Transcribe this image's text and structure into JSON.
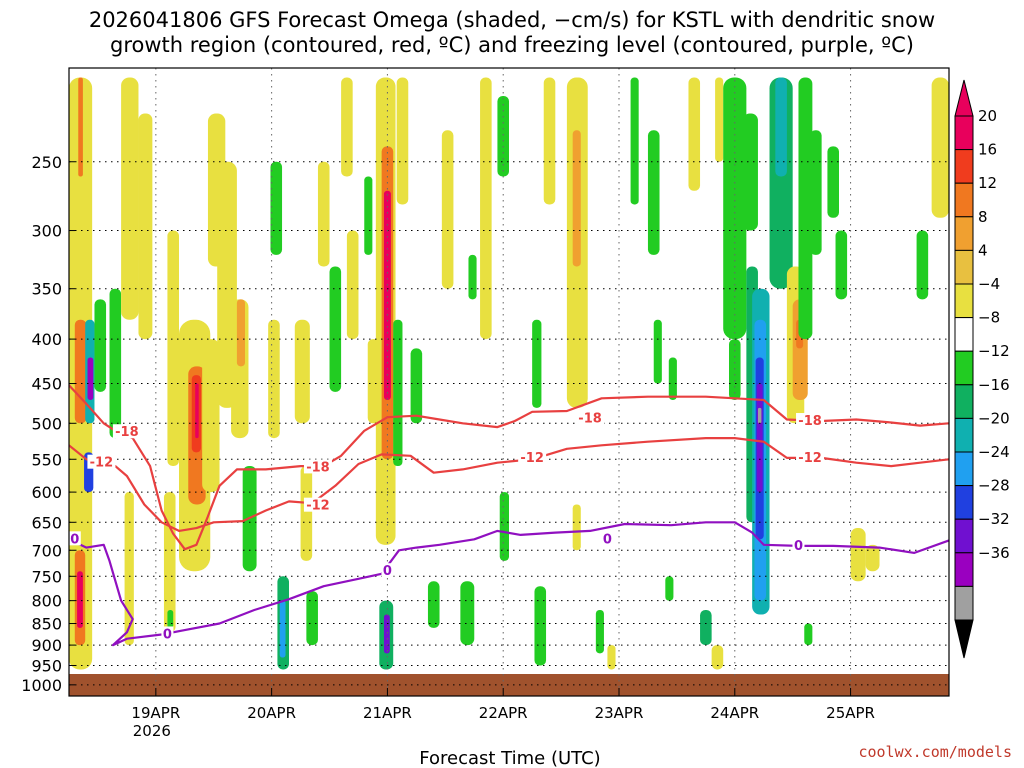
{
  "title_line1": "2026041806 GFS Forecast Omega (shaded, −cm/s) for KSTL with dendritic snow",
  "title_line2": "growth region (contoured, red, ºC) and freezing level (contoured, purple, ºC)",
  "credit": "coolwx.com/models",
  "chart_data": {
    "type": "heatmap",
    "title": "2026041806 GFS Forecast Omega (shaded, −cm/s) for KSTL with dendritic snow growth region (contoured, red, ºC) and freezing level (contoured, purple, ºC)",
    "xlabel": "Forecast Time (UTC)",
    "ylabel": "",
    "y_scale": "log",
    "ylim": [
      1030,
      195
    ],
    "xlim": [
      0,
      7.6
    ],
    "x_ticks": [
      {
        "value": 0.75,
        "label": "19APR",
        "sub": "2026"
      },
      {
        "value": 1.75,
        "label": "20APR"
      },
      {
        "value": 2.75,
        "label": "21APR"
      },
      {
        "value": 3.75,
        "label": "22APR"
      },
      {
        "value": 4.75,
        "label": "23APR"
      },
      {
        "value": 5.75,
        "label": "24APR"
      },
      {
        "value": 6.75,
        "label": "25APR"
      }
    ],
    "y_ticks": [
      250,
      300,
      350,
      400,
      450,
      500,
      550,
      600,
      650,
      700,
      750,
      800,
      850,
      900,
      950,
      1000
    ],
    "grid": true,
    "colorbar": {
      "ticks": [
        "20",
        "16",
        "12",
        "8",
        "4",
        "−4",
        "−8",
        "−12",
        "−16",
        "−20",
        "−24",
        "−28",
        "−32",
        "−36"
      ],
      "colors": [
        "#e8005c",
        "#f03c1e",
        "#f07820",
        "#f0a030",
        "#e8c040",
        "#e8e040",
        "#ffffff",
        "#22cc22",
        "#10b060",
        "#10b0b0",
        "#20a0f0",
        "#2040e0",
        "#7010d0",
        "#9a00c0",
        "#a0a0a0"
      ]
    },
    "series": [
      {
        "name": "-18",
        "color": "#e84040",
        "points": [
          [
            0.0,
            452
          ],
          [
            0.15,
            475
          ],
          [
            0.3,
            500
          ],
          [
            0.4,
            510
          ],
          [
            0.55,
            520
          ],
          [
            0.7,
            560
          ],
          [
            0.8,
            630
          ],
          [
            0.9,
            670
          ],
          [
            1.0,
            698
          ],
          [
            1.1,
            690
          ],
          [
            1.2,
            640
          ],
          [
            1.3,
            590
          ],
          [
            1.45,
            565
          ],
          [
            1.7,
            565
          ],
          [
            2.0,
            560
          ],
          [
            2.2,
            560
          ],
          [
            2.35,
            545
          ],
          [
            2.55,
            510
          ],
          [
            2.75,
            492
          ],
          [
            3.0,
            490
          ],
          [
            3.2,
            495
          ],
          [
            3.4,
            500
          ],
          [
            3.7,
            505
          ],
          [
            3.85,
            497
          ],
          [
            4.0,
            485
          ],
          [
            4.3,
            484
          ],
          [
            4.6,
            468
          ],
          [
            5.0,
            466
          ],
          [
            5.5,
            466
          ],
          [
            5.75,
            468
          ],
          [
            6.0,
            470
          ],
          [
            6.2,
            495
          ],
          [
            6.5,
            497
          ],
          [
            6.8,
            495
          ],
          [
            7.1,
            499
          ],
          [
            7.35,
            503
          ],
          [
            7.6,
            500
          ]
        ]
      },
      {
        "name": "-12",
        "color": "#e84040",
        "points": [
          [
            0.0,
            530
          ],
          [
            0.15,
            550
          ],
          [
            0.4,
            560
          ],
          [
            0.5,
            575
          ],
          [
            0.65,
            620
          ],
          [
            0.8,
            650
          ],
          [
            0.95,
            665
          ],
          [
            1.1,
            660
          ],
          [
            1.25,
            650
          ],
          [
            1.5,
            648
          ],
          [
            1.7,
            630
          ],
          [
            1.9,
            615
          ],
          [
            2.1,
            618
          ],
          [
            2.3,
            590
          ],
          [
            2.5,
            557
          ],
          [
            2.7,
            543
          ],
          [
            2.95,
            545
          ],
          [
            3.15,
            570
          ],
          [
            3.4,
            565
          ],
          [
            3.7,
            555
          ],
          [
            4.0,
            550
          ],
          [
            4.3,
            535
          ],
          [
            4.6,
            530
          ],
          [
            5.0,
            525
          ],
          [
            5.5,
            520
          ],
          [
            5.75,
            520
          ],
          [
            6.0,
            525
          ],
          [
            6.2,
            548
          ],
          [
            6.5,
            548
          ],
          [
            6.8,
            555
          ],
          [
            7.1,
            560
          ],
          [
            7.35,
            555
          ],
          [
            7.6,
            550
          ]
        ]
      },
      {
        "name": "0",
        "color": "#9010c0",
        "points": [
          [
            0.0,
            680
          ],
          [
            0.15,
            695
          ],
          [
            0.3,
            690
          ],
          [
            0.35,
            720
          ],
          [
            0.45,
            800
          ],
          [
            0.55,
            840
          ],
          [
            0.5,
            870
          ],
          [
            0.38,
            900
          ],
          [
            0.5,
            885
          ],
          [
            0.8,
            875
          ],
          [
            1.0,
            865
          ],
          [
            1.3,
            850
          ],
          [
            1.6,
            820
          ],
          [
            1.9,
            797
          ],
          [
            2.2,
            770
          ],
          [
            2.5,
            755
          ],
          [
            2.7,
            745
          ],
          [
            2.85,
            700
          ],
          [
            3.0,
            695
          ],
          [
            3.2,
            690
          ],
          [
            3.5,
            680
          ],
          [
            3.7,
            665
          ],
          [
            3.9,
            672
          ],
          [
            4.2,
            668
          ],
          [
            4.5,
            665
          ],
          [
            4.8,
            653
          ],
          [
            5.2,
            655
          ],
          [
            5.5,
            650
          ],
          [
            5.75,
            650
          ],
          [
            5.9,
            668
          ],
          [
            6.0,
            690
          ],
          [
            6.3,
            692
          ],
          [
            6.6,
            692
          ],
          [
            7.0,
            695
          ],
          [
            7.3,
            705
          ],
          [
            7.6,
            682
          ]
        ]
      }
    ],
    "contour_labels": [
      {
        "text": "-18",
        "x": 0.5,
        "y": 512
      },
      {
        "text": "-18",
        "x": 2.15,
        "y": 562
      },
      {
        "text": "-18",
        "x": 4.5,
        "y": 494
      },
      {
        "text": "-18",
        "x": 6.4,
        "y": 497
      },
      {
        "text": "-12",
        "x": 0.28,
        "y": 555
      },
      {
        "text": "-12",
        "x": 2.15,
        "y": 622
      },
      {
        "text": "-12",
        "x": 4.0,
        "y": 548
      },
      {
        "text": "-12",
        "x": 6.4,
        "y": 548
      },
      {
        "text": "0",
        "x": 0.05,
        "y": 680
      },
      {
        "text": "0",
        "x": 0.85,
        "y": 875
      },
      {
        "text": "0",
        "x": 2.75,
        "y": 740
      },
      {
        "text": "0",
        "x": 4.65,
        "y": 680
      },
      {
        "text": "0",
        "x": 6.3,
        "y": 692
      }
    ],
    "omega_cells": [
      {
        "x0": 0.0,
        "x1": 0.2,
        "p0": 200,
        "p1": 960,
        "v": 6
      },
      {
        "x0": 0.05,
        "x1": 0.15,
        "p0": 380,
        "p1": 500,
        "v": 14
      },
      {
        "x0": 0.05,
        "x1": 0.14,
        "p0": 700,
        "p1": 900,
        "v": 14
      },
      {
        "x0": 0.07,
        "x1": 0.12,
        "p0": 740,
        "p1": 860,
        "v": 22
      },
      {
        "x0": 0.08,
        "x1": 0.12,
        "p0": 200,
        "p1": 260,
        "v": 14
      },
      {
        "x0": 0.14,
        "x1": 0.22,
        "p0": 380,
        "p1": 500,
        "v": -14
      },
      {
        "x0": 0.16,
        "x1": 0.21,
        "p0": 420,
        "p1": 470,
        "v": -30
      },
      {
        "x0": 0.13,
        "x1": 0.21,
        "p0": 540,
        "p1": 600,
        "v": -22
      },
      {
        "x0": 0.22,
        "x1": 0.32,
        "p0": 360,
        "p1": 460,
        "v": -6
      },
      {
        "x0": 0.35,
        "x1": 0.45,
        "p0": 350,
        "p1": 520,
        "v": -6
      },
      {
        "x0": 0.45,
        "x1": 0.6,
        "p0": 200,
        "p1": 380,
        "v": 6
      },
      {
        "x0": 0.48,
        "x1": 0.56,
        "p0": 600,
        "p1": 900,
        "v": 6
      },
      {
        "x0": 0.6,
        "x1": 0.72,
        "p0": 220,
        "p1": 400,
        "v": 6
      },
      {
        "x0": 0.82,
        "x1": 0.92,
        "p0": 600,
        "p1": 870,
        "v": 6
      },
      {
        "x0": 0.85,
        "x1": 0.95,
        "p0": 300,
        "p1": 560,
        "v": 6
      },
      {
        "x0": 0.85,
        "x1": 0.9,
        "p0": 820,
        "p1": 860,
        "v": -6
      },
      {
        "x0": 0.95,
        "x1": 1.22,
        "p0": 380,
        "p1": 740,
        "v": 6
      },
      {
        "x0": 1.03,
        "x1": 1.18,
        "p0": 430,
        "p1": 620,
        "v": 12
      },
      {
        "x0": 1.06,
        "x1": 1.14,
        "p0": 440,
        "p1": 540,
        "v": 18
      },
      {
        "x0": 1.09,
        "x1": 1.12,
        "p0": 450,
        "p1": 520,
        "v": 22
      },
      {
        "x0": 1.15,
        "x1": 1.3,
        "p0": 400,
        "p1": 600,
        "v": 6
      },
      {
        "x0": 1.2,
        "x1": 1.35,
        "p0": 220,
        "p1": 330,
        "v": 6
      },
      {
        "x0": 1.28,
        "x1": 1.45,
        "p0": 250,
        "p1": 480,
        "v": 6
      },
      {
        "x0": 1.4,
        "x1": 1.55,
        "p0": 360,
        "p1": 520,
        "v": 6
      },
      {
        "x0": 1.45,
        "x1": 1.52,
        "p0": 360,
        "p1": 430,
        "v": 10
      },
      {
        "x0": 1.5,
        "x1": 1.62,
        "p0": 560,
        "p1": 740,
        "v": -6
      },
      {
        "x0": 1.72,
        "x1": 1.82,
        "p0": 380,
        "p1": 520,
        "v": 6
      },
      {
        "x0": 1.74,
        "x1": 1.84,
        "p0": 250,
        "p1": 320,
        "v": -6
      },
      {
        "x0": 1.8,
        "x1": 1.9,
        "p0": 750,
        "p1": 960,
        "v": -10
      },
      {
        "x0": 1.82,
        "x1": 1.87,
        "p0": 800,
        "p1": 930,
        "v": -18
      },
      {
        "x0": 1.95,
        "x1": 2.08,
        "p0": 380,
        "p1": 500,
        "v": 6
      },
      {
        "x0": 2.0,
        "x1": 2.1,
        "p0": 560,
        "p1": 720,
        "v": 6
      },
      {
        "x0": 2.05,
        "x1": 2.15,
        "p0": 780,
        "p1": 900,
        "v": -6
      },
      {
        "x0": 2.15,
        "x1": 2.25,
        "p0": 250,
        "p1": 330,
        "v": 6
      },
      {
        "x0": 2.25,
        "x1": 2.35,
        "p0": 330,
        "p1": 460,
        "v": -6
      },
      {
        "x0": 2.35,
        "x1": 2.45,
        "p0": 200,
        "p1": 260,
        "v": 6
      },
      {
        "x0": 2.4,
        "x1": 2.5,
        "p0": 300,
        "p1": 400,
        "v": 6
      },
      {
        "x0": 2.55,
        "x1": 2.62,
        "p0": 260,
        "p1": 320,
        "v": -6
      },
      {
        "x0": 2.58,
        "x1": 2.68,
        "p0": 400,
        "p1": 500,
        "v": 6
      },
      {
        "x0": 2.65,
        "x1": 2.82,
        "p0": 200,
        "p1": 690,
        "v": 6
      },
      {
        "x0": 2.7,
        "x1": 2.8,
        "p0": 240,
        "p1": 550,
        "v": 12
      },
      {
        "x0": 2.72,
        "x1": 2.78,
        "p0": 270,
        "p1": 470,
        "v": 22
      },
      {
        "x0": 2.68,
        "x1": 2.8,
        "p0": 800,
        "p1": 960,
        "v": -10
      },
      {
        "x0": 2.72,
        "x1": 2.77,
        "p0": 830,
        "p1": 920,
        "v": -24
      },
      {
        "x0": 2.8,
        "x1": 2.88,
        "p0": 380,
        "p1": 560,
        "v": -6
      },
      {
        "x0": 2.83,
        "x1": 2.93,
        "p0": 200,
        "p1": 280,
        "v": 6
      },
      {
        "x0": 2.95,
        "x1": 3.05,
        "p0": 410,
        "p1": 500,
        "v": -6
      },
      {
        "x0": 3.1,
        "x1": 3.2,
        "p0": 760,
        "p1": 860,
        "v": -6
      },
      {
        "x0": 3.22,
        "x1": 3.32,
        "p0": 230,
        "p1": 350,
        "v": 6
      },
      {
        "x0": 3.38,
        "x1": 3.5,
        "p0": 760,
        "p1": 900,
        "v": -6
      },
      {
        "x0": 3.45,
        "x1": 3.52,
        "p0": 320,
        "p1": 360,
        "v": -6
      },
      {
        "x0": 3.55,
        "x1": 3.65,
        "p0": 200,
        "p1": 400,
        "v": 6
      },
      {
        "x0": 3.72,
        "x1": 3.8,
        "p0": 600,
        "p1": 720,
        "v": -6
      },
      {
        "x0": 3.7,
        "x1": 3.8,
        "p0": 210,
        "p1": 260,
        "v": -6
      },
      {
        "x0": 4.0,
        "x1": 4.08,
        "p0": 380,
        "p1": 480,
        "v": -6
      },
      {
        "x0": 4.02,
        "x1": 4.12,
        "p0": 770,
        "p1": 950,
        "v": -6
      },
      {
        "x0": 4.1,
        "x1": 4.2,
        "p0": 200,
        "p1": 280,
        "v": 6
      },
      {
        "x0": 4.3,
        "x1": 4.48,
        "p0": 200,
        "p1": 480,
        "v": 6
      },
      {
        "x0": 4.35,
        "x1": 4.42,
        "p0": 230,
        "p1": 330,
        "v": 10
      },
      {
        "x0": 4.35,
        "x1": 4.42,
        "p0": 620,
        "p1": 700,
        "v": 6
      },
      {
        "x0": 4.55,
        "x1": 4.62,
        "p0": 820,
        "p1": 920,
        "v": -6
      },
      {
        "x0": 4.65,
        "x1": 4.72,
        "p0": 900,
        "p1": 960,
        "v": 6
      },
      {
        "x0": 4.85,
        "x1": 4.92,
        "p0": 200,
        "p1": 280,
        "v": -6
      },
      {
        "x0": 5.0,
        "x1": 5.1,
        "p0": 230,
        "p1": 320,
        "v": -6
      },
      {
        "x0": 5.05,
        "x1": 5.12,
        "p0": 380,
        "p1": 450,
        "v": -6
      },
      {
        "x0": 5.15,
        "x1": 5.22,
        "p0": 750,
        "p1": 800,
        "v": -6
      },
      {
        "x0": 5.18,
        "x1": 5.25,
        "p0": 420,
        "p1": 470,
        "v": -6
      },
      {
        "x0": 5.35,
        "x1": 5.45,
        "p0": 200,
        "p1": 270,
        "v": 6
      },
      {
        "x0": 5.45,
        "x1": 5.55,
        "p0": 820,
        "p1": 900,
        "v": -10
      },
      {
        "x0": 5.55,
        "x1": 5.65,
        "p0": 900,
        "p1": 960,
        "v": 6
      },
      {
        "x0": 5.58,
        "x1": 5.65,
        "p0": 200,
        "p1": 250,
        "v": 6
      },
      {
        "x0": 5.65,
        "x1": 5.85,
        "p0": 200,
        "p1": 400,
        "v": -6
      },
      {
        "x0": 5.7,
        "x1": 5.8,
        "p0": 400,
        "p1": 470,
        "v": -6
      },
      {
        "x0": 5.82,
        "x1": 5.95,
        "p0": 220,
        "p1": 300,
        "v": -6
      },
      {
        "x0": 5.85,
        "x1": 5.95,
        "p0": 330,
        "p1": 650,
        "v": -10
      },
      {
        "x0": 5.9,
        "x1": 6.05,
        "p0": 350,
        "p1": 830,
        "v": -14
      },
      {
        "x0": 5.92,
        "x1": 6.02,
        "p0": 380,
        "p1": 800,
        "v": -18
      },
      {
        "x0": 5.93,
        "x1": 6.0,
        "p0": 420,
        "p1": 680,
        "v": -22
      },
      {
        "x0": 5.94,
        "x1": 5.99,
        "p0": 450,
        "p1": 600,
        "v": -26
      },
      {
        "x0": 5.95,
        "x1": 5.98,
        "p0": 480,
        "p1": 500,
        "v": -34
      },
      {
        "x0": 6.05,
        "x1": 6.25,
        "p0": 200,
        "p1": 350,
        "v": -10
      },
      {
        "x0": 6.1,
        "x1": 6.2,
        "p0": 200,
        "p1": 260,
        "v": -14
      },
      {
        "x0": 6.2,
        "x1": 6.35,
        "p0": 330,
        "p1": 500,
        "v": 6
      },
      {
        "x0": 6.25,
        "x1": 6.38,
        "p0": 360,
        "p1": 470,
        "v": 10
      },
      {
        "x0": 6.28,
        "x1": 6.34,
        "p0": 380,
        "p1": 410,
        "v": 14
      },
      {
        "x0": 6.3,
        "x1": 6.42,
        "p0": 200,
        "p1": 400,
        "v": -6
      },
      {
        "x0": 6.4,
        "x1": 6.5,
        "p0": 230,
        "p1": 320,
        "v": -6
      },
      {
        "x0": 6.55,
        "x1": 6.65,
        "p0": 240,
        "p1": 290,
        "v": -6
      },
      {
        "x0": 6.62,
        "x1": 6.72,
        "p0": 300,
        "p1": 360,
        "v": -6
      },
      {
        "x0": 6.35,
        "x1": 6.42,
        "p0": 850,
        "p1": 900,
        "v": -6
      },
      {
        "x0": 6.75,
        "x1": 6.88,
        "p0": 660,
        "p1": 760,
        "v": 6
      },
      {
        "x0": 6.88,
        "x1": 7.0,
        "p0": 690,
        "p1": 740,
        "v": 6
      },
      {
        "x0": 7.32,
        "x1": 7.42,
        "p0": 300,
        "p1": 360,
        "v": -6
      },
      {
        "x0": 7.45,
        "x1": 7.6,
        "p0": 200,
        "p1": 290,
        "v": 6
      }
    ]
  }
}
